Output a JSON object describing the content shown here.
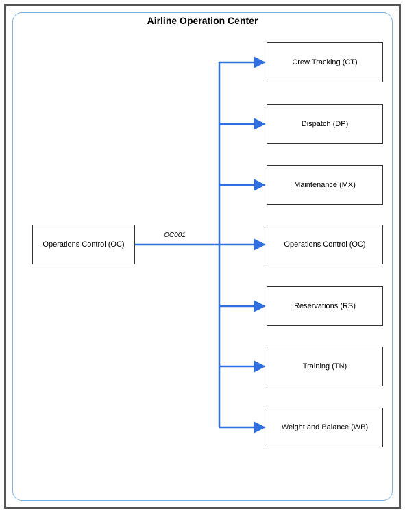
{
  "diagram": {
    "title": "Airline Operation Center",
    "source_node": {
      "label": "Operations Control (OC)"
    },
    "edge_label": "OC001",
    "target_nodes": [
      {
        "label": "Crew Tracking (CT)"
      },
      {
        "label": "Dispatch (DP)"
      },
      {
        "label": "Maintenance (MX)"
      },
      {
        "label": "Operations Control (OC)"
      },
      {
        "label": "Reservations (RS)"
      },
      {
        "label": "Training (TN)"
      },
      {
        "label": "Weight and Balance (WB)"
      }
    ],
    "colors": {
      "connector": "#2f6fe0",
      "inner_frame": "#7bb0e0",
      "outer_frame": "#555"
    }
  }
}
